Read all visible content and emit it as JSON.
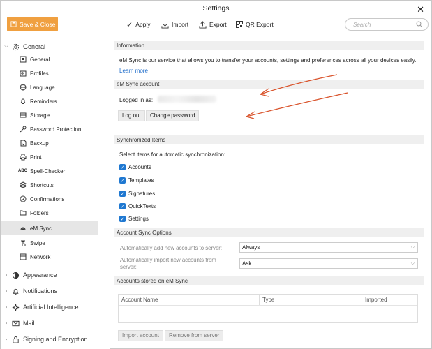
{
  "window": {
    "title": "Settings"
  },
  "toolbar": {
    "save_close": "Save & Close",
    "apply": "Apply",
    "import": "Import",
    "export": "Export",
    "qr_export": "QR Export",
    "search_placeholder": "Search"
  },
  "sidebar": {
    "general_group": "General",
    "items": [
      {
        "label": "General",
        "icon": "list-icon"
      },
      {
        "label": "Profiles",
        "icon": "profiles-icon"
      },
      {
        "label": "Language",
        "icon": "globe-icon"
      },
      {
        "label": "Reminders",
        "icon": "bell-icon"
      },
      {
        "label": "Storage",
        "icon": "storage-icon"
      },
      {
        "label": "Password Protection",
        "icon": "key-icon"
      },
      {
        "label": "Backup",
        "icon": "backup-icon"
      },
      {
        "label": "Print",
        "icon": "printer-icon"
      },
      {
        "label": "Spell-Checker",
        "icon": "spellcheck-icon"
      },
      {
        "label": "Shortcuts",
        "icon": "shortcuts-icon"
      },
      {
        "label": "Confirmations",
        "icon": "check-circle-icon"
      },
      {
        "label": "Folders",
        "icon": "folder-icon"
      },
      {
        "label": "eM Sync",
        "icon": "sync-icon"
      },
      {
        "label": "Swipe",
        "icon": "swipe-icon"
      },
      {
        "label": "Network",
        "icon": "network-icon"
      }
    ],
    "appearance": "Appearance",
    "notifications": "Notifications",
    "ai": "Artificial Intelligence",
    "mail": "Mail",
    "signing": "Signing and Encryption"
  },
  "information": {
    "header": "Information",
    "text": "eM Sync is our service that allows you to transfer your accounts, settings and preferences across all your devices easily.",
    "learn_more": "Learn more"
  },
  "account": {
    "header": "eM Sync account",
    "logged_in_as": "Logged in as:",
    "logout": "Log out",
    "change_password": "Change password"
  },
  "synced": {
    "header": "Synchronized Items",
    "prompt": "Select items for automatic synchronization:",
    "items": [
      "Accounts",
      "Templates",
      "Signatures",
      "QuickTexts",
      "Settings"
    ]
  },
  "options": {
    "header": "Account Sync Options",
    "add_label": "Automatically add new accounts to server:",
    "add_value": "Always",
    "import_label_1": "Automatically import new accounts from",
    "import_label_2": "server:",
    "import_value": "Ask"
  },
  "stored": {
    "header": "Accounts stored on eM Sync",
    "columns": [
      "Account Name",
      "Type",
      "Imported"
    ],
    "import_btn": "Import account",
    "remove_btn": "Remove from server"
  },
  "colors": {
    "accent": "#f0a040",
    "checkbox": "#1f78d1",
    "link": "#1b6ac9",
    "annotation": "#d9532b"
  }
}
